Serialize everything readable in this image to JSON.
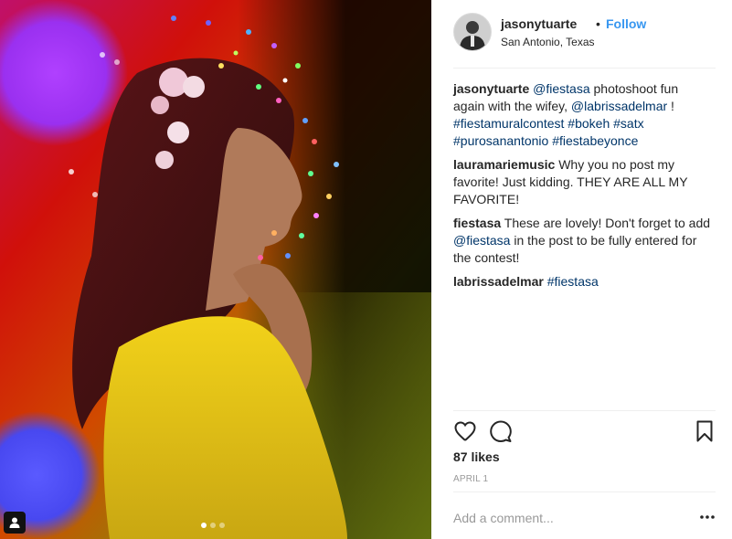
{
  "post": {
    "username": "jasonytuarte",
    "separator": "•",
    "follow_label": "Follow",
    "location": "San Antonio, Texas"
  },
  "caption": {
    "username": "jasonytuarte",
    "mention1": "@fiestasa",
    "text1": " photoshoot fun again with the wifey, ",
    "mention2": "@labrissadelmar",
    "text2": " ! ",
    "tags": [
      "#fiestamuralcontest",
      "#bokeh",
      "#satx",
      "#purosanantonio",
      "#fiestabeyonce"
    ]
  },
  "comments": [
    {
      "username": "lauramariemusic",
      "text": "Why you no post my favorite! Just kidding. THEY ARE ALL MY FAVORITE!"
    },
    {
      "username": "fiestasa",
      "text1": "These are lovely! Don't forget to add ",
      "mention": "@fiestasa",
      "text2": " in the post to be fully entered for the contest!"
    },
    {
      "username": "labrissadelmar",
      "tag": "#fiestasa"
    }
  ],
  "likes": "87 likes",
  "date": "APRIL 1",
  "add_comment": {
    "placeholder": "Add a comment..."
  },
  "icons": {
    "like": "heart-icon",
    "comment": "speech-bubble-icon",
    "save": "bookmark-icon",
    "more": "more-options-icon",
    "user_tag": "user-tag-icon"
  },
  "colors": {
    "link": "#003569",
    "follow": "#3897f0",
    "text": "#262626",
    "muted": "#999999"
  }
}
